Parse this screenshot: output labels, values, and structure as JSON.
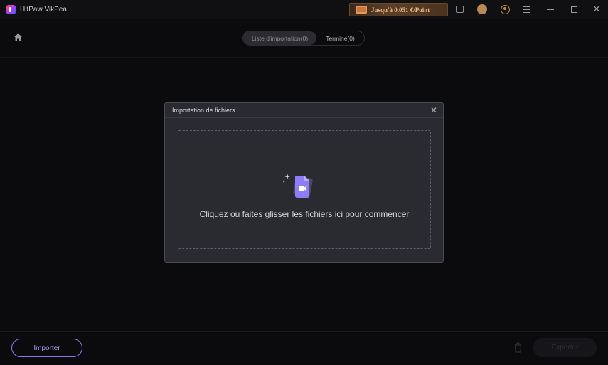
{
  "app": {
    "title": "HitPaw VikPea",
    "logo_icon": "hitpaw-logo-icon"
  },
  "titlebar": {
    "promo_text": "Jusqu'à 0.051 €/Point",
    "icons": [
      "feedback-icon",
      "coin-icon",
      "user-account-icon",
      "menu-icon",
      "minimize-icon",
      "maximize-icon",
      "close-icon"
    ],
    "close_glyph": "✕"
  },
  "tabs": {
    "import_list": "Liste d'importation(0)",
    "done": "Terminé(0)"
  },
  "dialog": {
    "title": "Importation de fichiers",
    "close_glyph": "✕",
    "drop_text": "Cliquez ou faites glisser les fichiers ici pour commencer"
  },
  "bottom": {
    "import_label": "Importer",
    "export_label": "Exporter"
  },
  "colors": {
    "background": "#0b0b0d",
    "dialog": "#2a2a31",
    "accent": "#8a7cf0"
  }
}
